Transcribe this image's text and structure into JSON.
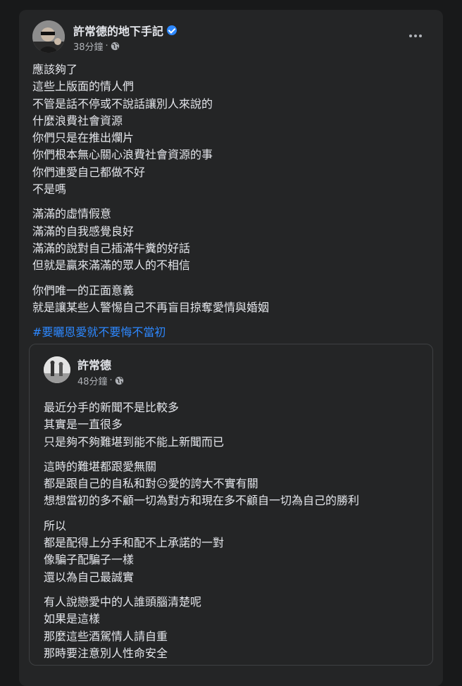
{
  "post": {
    "author": "許常德的地下手記",
    "time": "38分鐘",
    "dot": "·",
    "paragraphs": [
      [
        "應該夠了",
        "這些上版面的情人們",
        "不管是話不停或不說話讓別人來說的",
        "什麼浪費社會資源",
        "你們只是在推出爛片",
        "你們根本無心關心浪費社會資源的事",
        "你們連愛自己都做不好",
        "不是嗎"
      ],
      [
        "滿滿的虛情假意",
        "滿滿的自我感覺良好",
        "滿滿的說對自己插滿牛糞的好話",
        "但就是贏來滿滿的眾人的不相信"
      ],
      [
        "你們唯一的正面意義",
        "就是讓某些人警惕自己不再盲目掠奪愛情與婚姻"
      ]
    ],
    "hashtag": "#要曬恩愛就不要悔不當初"
  },
  "shared": {
    "author": "許常德",
    "time": "48分鐘",
    "dot": "·",
    "paragraphs": [
      [
        "最近分手的新聞不是比較多",
        "其實是一直很多",
        "只是夠不夠難堪到能不能上新聞而已"
      ],
      [
        "這時的難堪都跟愛無關",
        "都是跟自己的自私和對☹愛的誇大不實有關",
        "想想當初的多不顧一切為對方和現在多不顧自一切為自己的勝利"
      ],
      [
        "所以",
        "都是配得上分手和配不上承諾的一對",
        "像騙子配騙子一樣",
        "還以為自己最誠實"
      ],
      [
        "有人說戀愛中的人誰頭腦清楚呢",
        "如果是這樣",
        "那麼這些酒駕情人請自重",
        "那時要注意別人性命安全"
      ]
    ]
  },
  "icons": {
    "verified": "verified-badge-icon",
    "audience": "globe-icon",
    "menu": "more-options-icon"
  },
  "colors": {
    "background": "#18191a",
    "card": "#242526",
    "text": "#e4e6eb",
    "secondary": "#b0b3b8",
    "link": "#2d88ff"
  }
}
